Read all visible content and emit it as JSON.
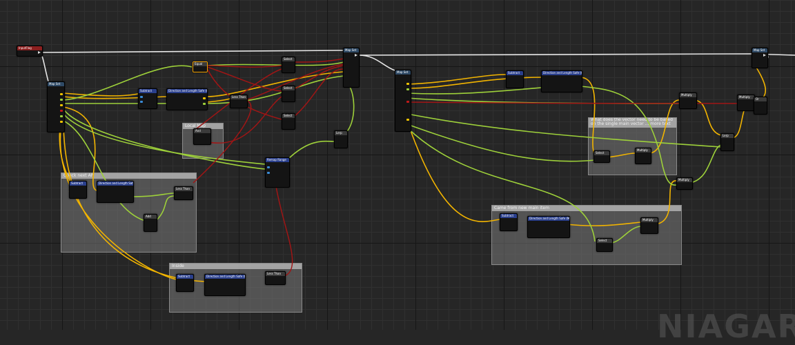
{
  "graph": {
    "watermark": "NIAGAR"
  },
  "comments": {
    "check_next_ap": "Check next AP",
    "inside": "Inside",
    "came_from_new_main_item": "Came from new main item",
    "what_does": "What does the vector need to be based on the single main vector ... more text",
    "small_box": "Local Map"
  },
  "nodes": {
    "input_flag": "InputFlag",
    "map_set_a": "Map Set",
    "map_set_b": "Map Set",
    "map_set_c": "Map Set",
    "map_set_d": "Map Set",
    "equal": "Equal",
    "subtract": "Subtract",
    "direction_length": "Direction and Length Safe (Mil)",
    "direction_length_short": "Direction and Length Safe",
    "less_than": "Less Than",
    "lerp": "Lerp",
    "remap_range": "Remap Range",
    "add": "Add",
    "select": "Select",
    "multiply": "Multiply",
    "and": "And",
    "or": "Or"
  },
  "colors": {
    "exec_wire": "#e6e6e6",
    "float_wire": "#f2b400",
    "vector_wire": "#9ed13a",
    "bool_wire": "#a01515",
    "graph_bg": "#262626"
  },
  "icons": {
    "exec_pin": "triangle-exec-icon",
    "data_pin": "circle-data-pin-icon"
  }
}
